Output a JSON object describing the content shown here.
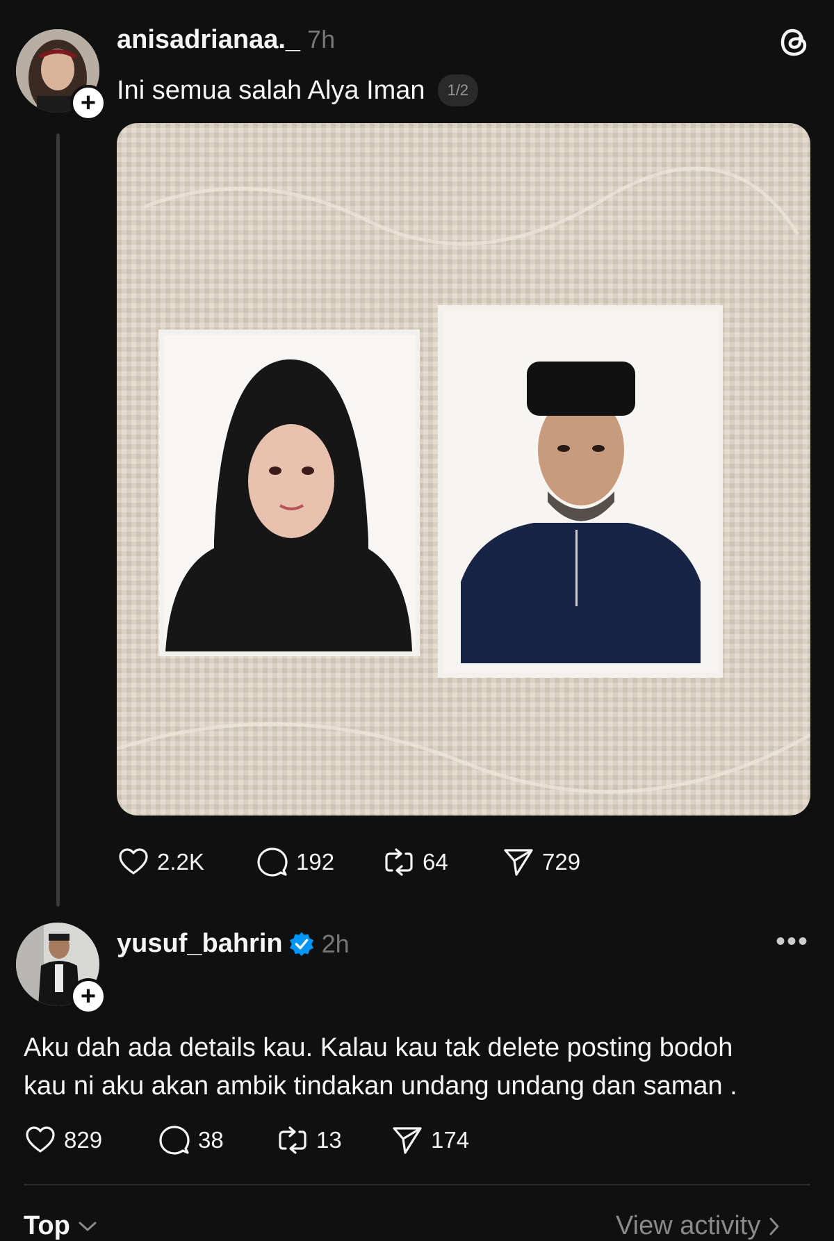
{
  "post1": {
    "username": "anisadrianaa._",
    "time": "7h",
    "text": "Ini semua salah Alya Iman",
    "page_indicator": "1/2",
    "stats": {
      "likes": "2.2K",
      "replies": "192",
      "reposts": "64",
      "shares": "729"
    }
  },
  "post2": {
    "username": "yusuf_bahrin",
    "verified": true,
    "time": "2h",
    "text_line1": "Aku dah ada details kau. Kalau kau tak delete posting bodoh",
    "text_line2": "kau ni aku akan ambik tindakan undang undang dan saman .",
    "stats": {
      "likes": "829",
      "replies": "38",
      "reposts": "13",
      "shares": "174"
    }
  },
  "footer": {
    "sort_label": "Top",
    "activity_label": "View activity"
  },
  "icons": {
    "threads_logo": "threads-logo-icon",
    "like": "heart-icon",
    "reply": "comment-icon",
    "repost": "repost-icon",
    "share": "send-icon",
    "verified": "verified-badge-icon",
    "more": "more-icon"
  },
  "colors": {
    "background": "#101010",
    "text": "#f3f5f7",
    "muted": "#777777",
    "verified": "#0095f6"
  }
}
